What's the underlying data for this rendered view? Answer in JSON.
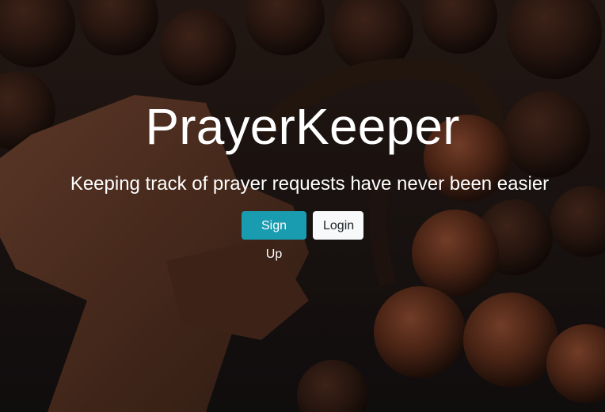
{
  "hero": {
    "title": "PrayerKeeper",
    "subtitle": "Keeping track of prayer requests have never been easier",
    "background_image": "rosary-beads-wooden-cross"
  },
  "actions": {
    "signup_label": "Sign Up",
    "login_label": "Login"
  },
  "colors": {
    "primary": "#1a9cb0",
    "light": "#f8f9fa",
    "text": "#ffffff"
  }
}
